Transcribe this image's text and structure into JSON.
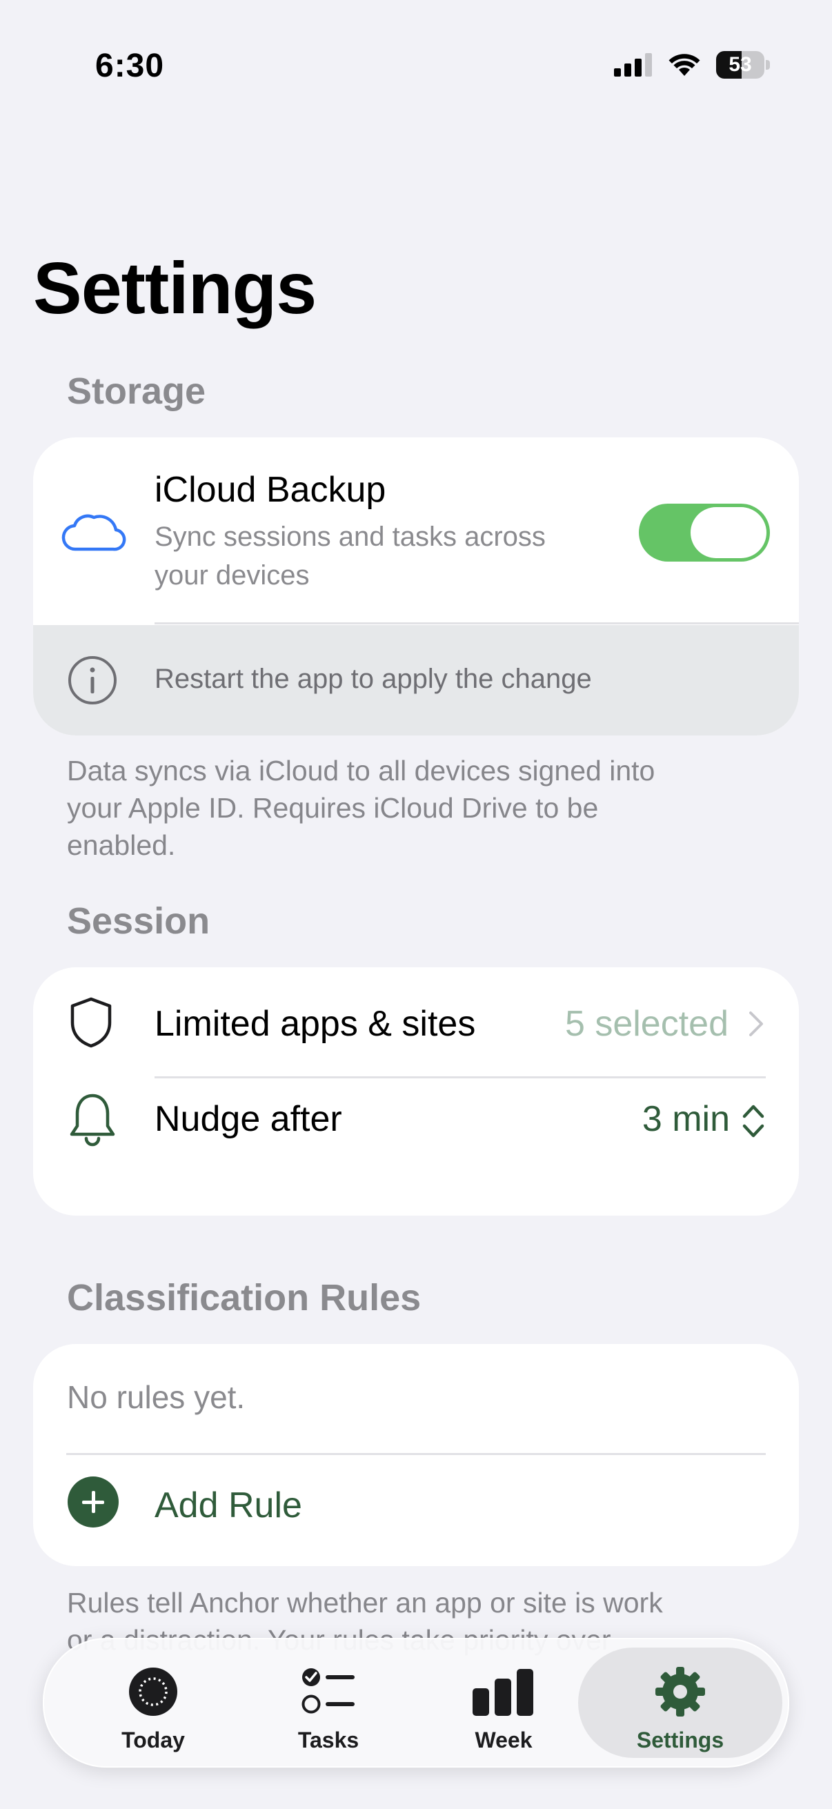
{
  "status_bar": {
    "time": "6:30",
    "battery": "53",
    "battery_level": 0.53
  },
  "page": {
    "title": "Settings"
  },
  "storage": {
    "header": "Storage",
    "icloud_title": "iCloud Backup",
    "icloud_subtitle_line1": "Sync sessions and tasks across",
    "icloud_subtitle_line2": "your devices",
    "toggle_on": true,
    "info_text": "Restart the app to apply the change",
    "footer_line1": "Data syncs via iCloud to all devices signed into",
    "footer_line2": "your Apple ID. Requires iCloud Drive to be",
    "footer_line3": "enabled."
  },
  "session": {
    "header": "Session",
    "limited_label": "Limited apps & sites",
    "limited_value": "5 selected",
    "nudge_label": "Nudge after",
    "nudge_value": "3 min"
  },
  "rules": {
    "header": "Classification Rules",
    "empty_text": "No rules yet.",
    "add_label": "Add Rule",
    "footer_line1": "Rules tell Anchor whether an app or site is work",
    "footer_line2": "or a distraction. Your rules take priority over"
  },
  "tabs": [
    {
      "label": "Today"
    },
    {
      "label": "Tasks"
    },
    {
      "label": "Week"
    },
    {
      "label": "Settings",
      "selected": true
    }
  ],
  "colors": {
    "accent_green": "#2f5b3a",
    "toggle_green": "#65c466",
    "icloud_blue": "#3478f6",
    "secondary_text": "#8a8a8e",
    "muted_green_value": "#a5bfae"
  }
}
